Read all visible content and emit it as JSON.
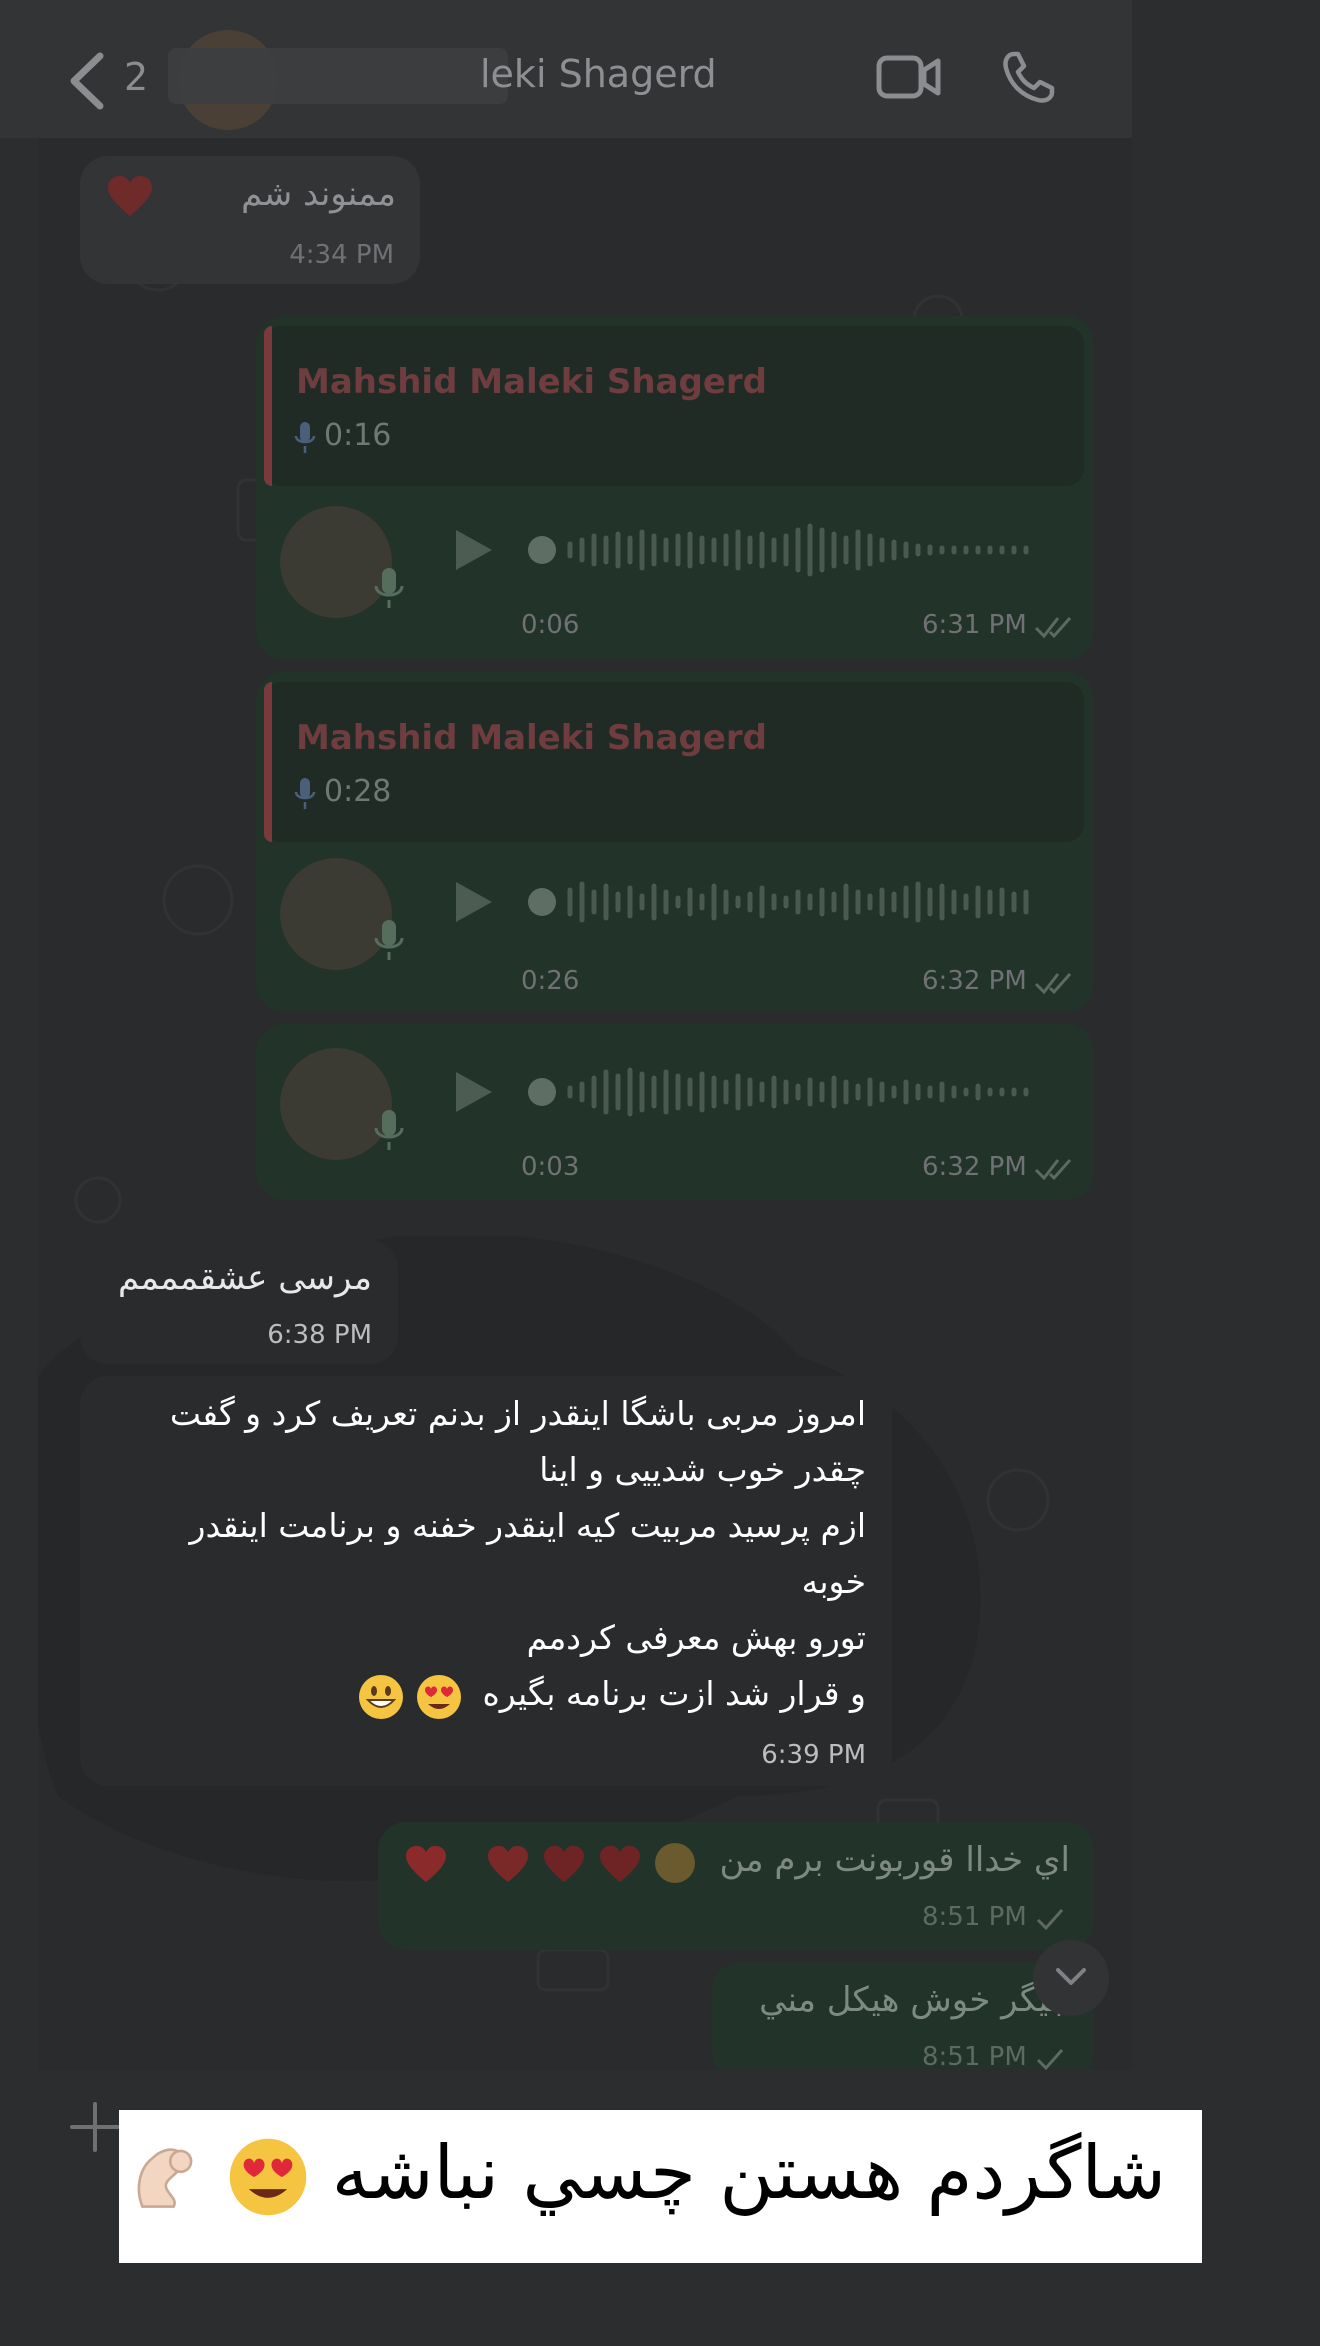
{
  "header": {
    "back_count": "2",
    "contact_name": "leki Shagerd"
  },
  "messages": {
    "m1": {
      "text": "ممنوند    شم",
      "time": "4:34 PM"
    },
    "v1": {
      "reply_name": "Mahshid Maleki Shagerd",
      "reply_duration": "0:16",
      "duration": "0:06",
      "time": "6:31 PM"
    },
    "v2": {
      "reply_name": "Mahshid Maleki Shagerd",
      "reply_duration": "0:28",
      "duration": "0:26",
      "time": "6:32 PM"
    },
    "v3": {
      "duration": "0:03",
      "time": "6:32 PM"
    },
    "m2": {
      "text": "مرسی عشقمممم",
      "time": "6:38 PM"
    },
    "m3": {
      "lines": [
        "امروز مربی باشگا اینقدر از بدنم تعریف کرد و گفت",
        "چقدر خوب شدییی و اینا",
        "ازم پرسید مربیت کیه اینقدر خفنه و برنامت اینقدر",
        "خوبه",
        "تورو بهش معرفی کردمم",
        "و قرار شد ازت برنامه بگیره"
      ],
      "time": "6:39 PM"
    },
    "m4": {
      "text": "اي خداا قوربونت برم من",
      "time": "8:51 PM"
    },
    "m5": {
      "text": "جیگر خوش هیکل مني",
      "time": "8:51 PM"
    }
  },
  "caption": {
    "text": "شاگردم هستن چسي نباشه"
  },
  "colors": {
    "accent_green": "#223329",
    "incoming": "#333436",
    "highlight_bubble": "#2a2b2d"
  },
  "icons": [
    "chevron-left-icon",
    "video-camera-icon",
    "phone-icon",
    "microphone-icon",
    "play-icon",
    "double-check-icon",
    "single-check-icon",
    "chevron-down-icon",
    "plus-icon"
  ]
}
